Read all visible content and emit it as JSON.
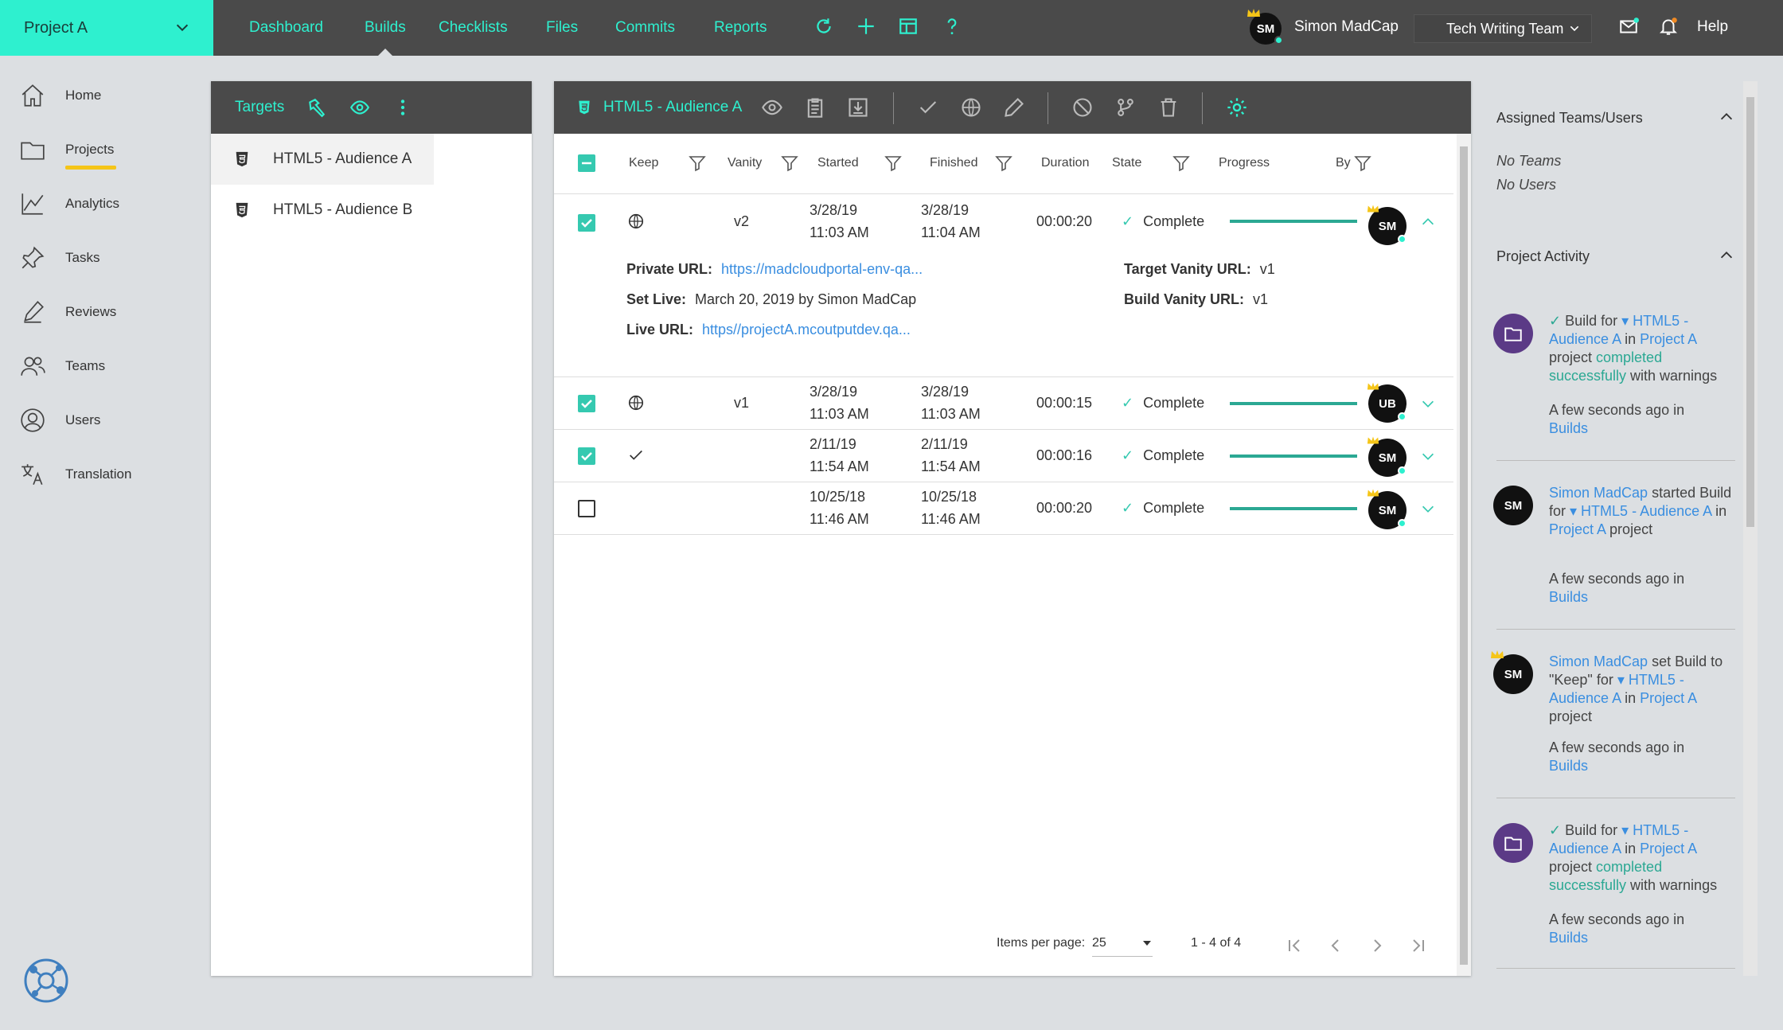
{
  "project": {
    "name": "Project A"
  },
  "topnav": {
    "items": [
      "Dashboard",
      "Builds",
      "Checklists",
      "Files",
      "Commits",
      "Reports"
    ],
    "active": "Builds"
  },
  "user": {
    "initials": "SM",
    "name": "Simon MadCap"
  },
  "team": {
    "selected": "Tech Writing Team"
  },
  "help": "Help",
  "leftnav": {
    "items": [
      "Home",
      "Projects",
      "Analytics",
      "Tasks",
      "Reviews",
      "Teams",
      "Users",
      "Translation"
    ],
    "active": "Projects"
  },
  "targets": {
    "title": "Targets",
    "items": [
      "HTML5 - Audience A",
      "HTML5 - Audience B"
    ],
    "selected": "HTML5 - Audience A"
  },
  "builds": {
    "title": "HTML5 - Audience A",
    "columns": [
      "Keep",
      "Vanity",
      "Started",
      "Finished",
      "Duration",
      "State",
      "Progress",
      "By"
    ],
    "rows": [
      {
        "keep": true,
        "icon": "globe-icon",
        "vanity": "v2",
        "started_date": "3/28/19",
        "started_time": "11:03 AM",
        "finished_date": "3/28/19",
        "finished_time": "11:04 AM",
        "duration": "00:00:20",
        "state": "Complete",
        "progress": 1.0,
        "by": "SM",
        "expanded": true
      },
      {
        "keep": true,
        "icon": "globe-icon",
        "vanity": "v1",
        "started_date": "3/28/19",
        "started_time": "11:03 AM",
        "finished_date": "3/28/19",
        "finished_time": "11:03 AM",
        "duration": "00:00:15",
        "state": "Complete",
        "progress": 1.0,
        "by": "UB",
        "expanded": false
      },
      {
        "keep": true,
        "icon": "check-icon",
        "vanity": "",
        "started_date": "2/11/19",
        "started_time": "11:54 AM",
        "finished_date": "2/11/19",
        "finished_time": "11:54 AM",
        "duration": "00:00:16",
        "state": "Complete",
        "progress": 1.0,
        "by": "SM",
        "expanded": false
      },
      {
        "keep": false,
        "icon": "",
        "vanity": "",
        "started_date": "10/25/18",
        "started_time": "11:46 AM",
        "finished_date": "10/25/18",
        "finished_time": "11:46 AM",
        "duration": "00:00:20",
        "state": "Complete",
        "progress": 1.0,
        "by": "SM",
        "expanded": false
      }
    ],
    "detail": {
      "private_url_label": "Private URL:",
      "private_url": "https://madcloudportal-env-qa...",
      "set_live_label": "Set Live:",
      "set_live": "March 20, 2019 by Simon MadCap",
      "live_url_label": "Live URL:",
      "live_url": "https//projectA.mcoutputdev.qa...",
      "target_vanity_label": "Target Vanity URL:",
      "target_vanity": "v1",
      "build_vanity_label": "Build Vanity URL:",
      "build_vanity": "v1"
    },
    "pager": {
      "items_per_page_label": "Items per page:",
      "items_per_page": "25",
      "range": "1 - 4 of 4"
    }
  },
  "right": {
    "assigned_title": "Assigned Teams/Users",
    "no_teams": "No Teams",
    "no_users": "No Users",
    "activity_title": "Project Activity",
    "activities": [
      {
        "time_text": "A few seconds ago in",
        "time_link": "Builds"
      },
      {
        "actor": "Simon MadCap",
        "time_text": "A few seconds ago in",
        "time_link": "Builds"
      },
      {
        "actor": "Simon MadCap",
        "time_text": "A few seconds ago in",
        "time_link": "Builds"
      },
      {
        "time_text": "A few seconds ago in",
        "time_link": "Builds"
      }
    ]
  },
  "colors": {
    "accent": "#2ef0cf",
    "teal": "#2ba893",
    "link": "#3a8ee0",
    "header": "#4a4a4a",
    "crown": "#f5c518"
  }
}
